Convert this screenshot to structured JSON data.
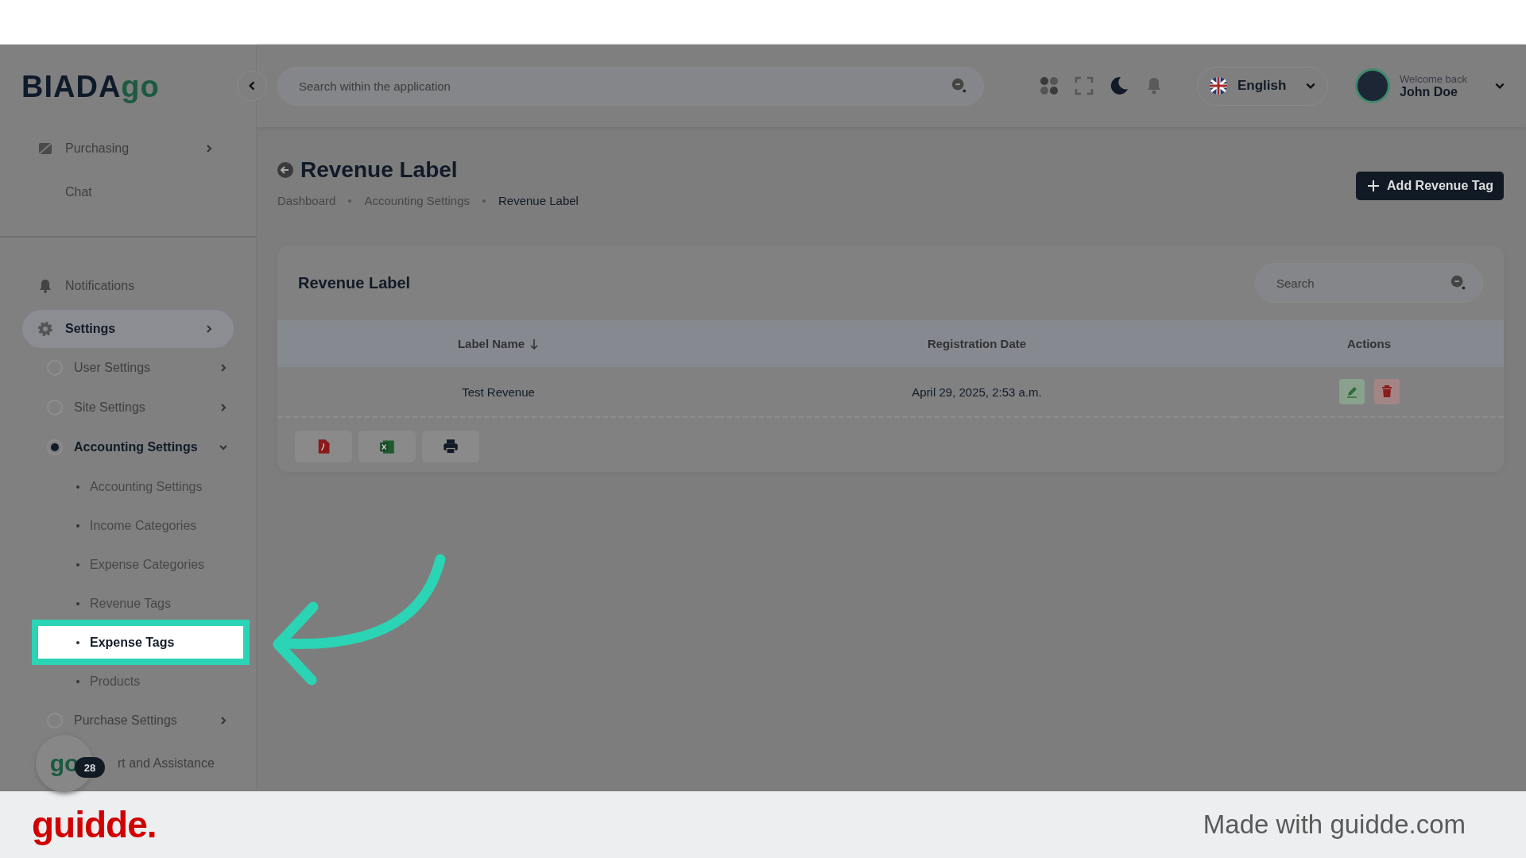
{
  "logo": {
    "dark": "BIADA",
    "accent": "go"
  },
  "header": {
    "search": {
      "placeholder": "Search within the application"
    },
    "language": "English",
    "user": {
      "greeting": "Welcome back",
      "name": "John Doe"
    }
  },
  "sidebar": {
    "top_items": [
      {
        "label": "Purchasing",
        "has_arrow": true
      },
      {
        "label": "Chat",
        "has_arrow": false
      }
    ],
    "items": [
      {
        "label": "Notifications",
        "has_arrow": false,
        "selected": false
      },
      {
        "label": "Settings",
        "has_arrow": true,
        "selected": true,
        "children": [
          {
            "label": "User Settings",
            "selected": false,
            "expanded": false
          },
          {
            "label": "Site Settings",
            "selected": false,
            "expanded": false
          },
          {
            "label": "Accounting Settings",
            "selected": true,
            "expanded": true,
            "children": [
              {
                "label": "Accounting Settings",
                "highlighted": false
              },
              {
                "label": "Income Categories",
                "highlighted": false
              },
              {
                "label": "Expense Categories",
                "highlighted": false
              },
              {
                "label": "Revenue Tags",
                "highlighted": false
              },
              {
                "label": "Expense Tags",
                "highlighted": true
              },
              {
                "label": "Products",
                "highlighted": false
              }
            ]
          },
          {
            "label": "Purchase Settings",
            "selected": false,
            "expanded": false
          }
        ]
      },
      {
        "label": "rt and Assistance",
        "has_arrow": false,
        "selected": false
      }
    ],
    "chat_logo": "go",
    "chat_badge": "28"
  },
  "page": {
    "title": "Revenue Label",
    "breadcrumb": [
      {
        "label": "Dashboard",
        "current": false
      },
      {
        "label": "Accounting Settings",
        "current": false
      },
      {
        "label": "Revenue Label",
        "current": true
      }
    ],
    "add_button": "Add Revenue Tag"
  },
  "card": {
    "title": "Revenue Label",
    "search": {
      "placeholder": "Search"
    },
    "table": {
      "columns": [
        {
          "label": "Label Name",
          "sorted": true
        },
        {
          "label": "Registration Date",
          "sorted": false
        },
        {
          "label": "Actions",
          "sorted": false
        }
      ],
      "rows": [
        {
          "cells": [
            "Test Revenue",
            "April 29, 2025, 2:53 a.m."
          ]
        }
      ]
    }
  },
  "footer": {
    "brand": "guidde.",
    "credit": "Made with guidde.com"
  }
}
